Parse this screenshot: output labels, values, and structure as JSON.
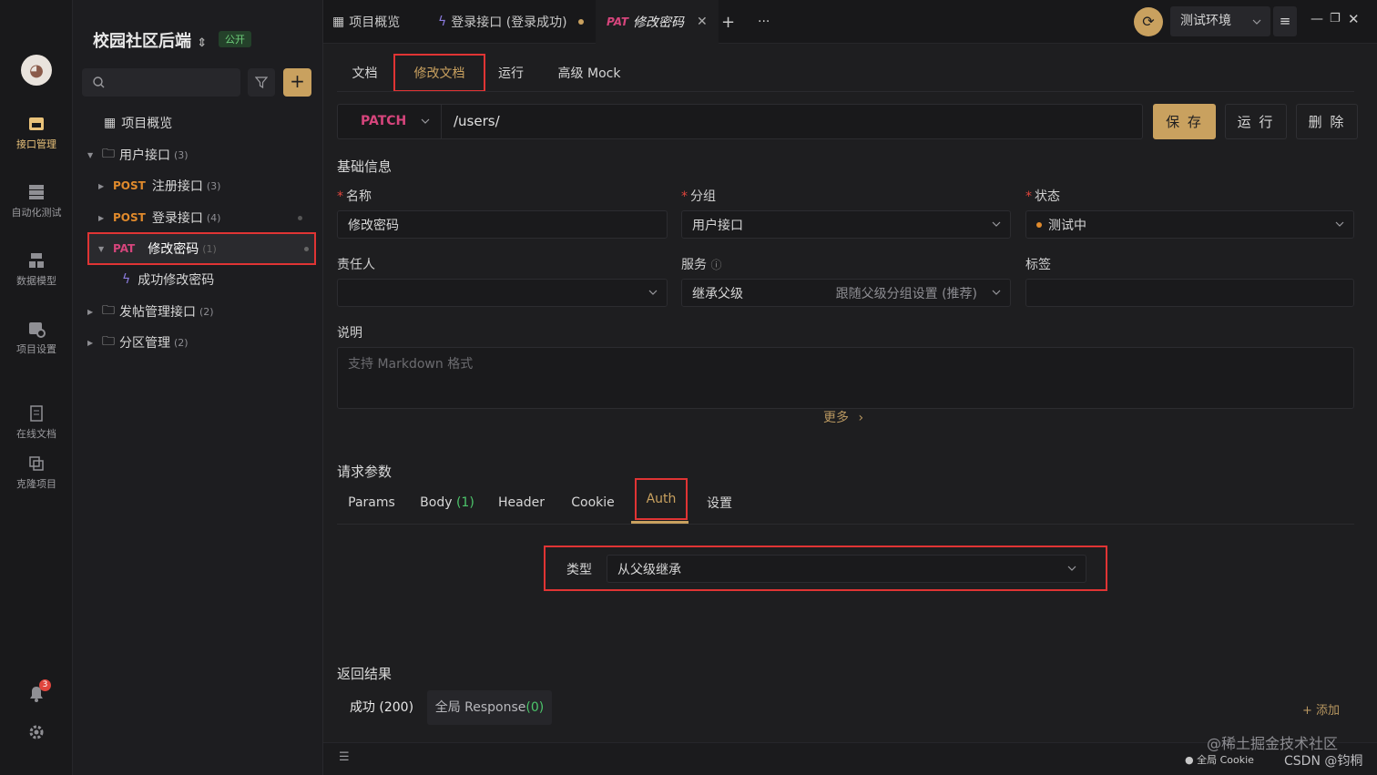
{
  "rail": {
    "items": [
      {
        "label": "接口管理",
        "icon": "api-icon"
      },
      {
        "label": "自动化测试",
        "icon": "automation-icon"
      },
      {
        "label": "数据模型",
        "icon": "data-model-icon"
      },
      {
        "label": "项目设置",
        "icon": "project-settings-icon"
      },
      {
        "label": "在线文档",
        "icon": "online-doc-icon"
      },
      {
        "label": "克隆项目",
        "icon": "clone-icon"
      }
    ],
    "notification_count": "3"
  },
  "sidebar": {
    "project_title": "校园社区后端",
    "visibility_badge": "公开",
    "tree": {
      "overview": "项目概览",
      "user_api": {
        "label": "用户接口",
        "count": "(3)"
      },
      "register": {
        "method": "POST",
        "label": "注册接口",
        "count": "(3)"
      },
      "login": {
        "method": "POST",
        "label": "登录接口",
        "count": "(4)"
      },
      "change_pwd": {
        "method": "PAT",
        "label": "修改密码",
        "count": "(1)"
      },
      "change_pwd_case": {
        "label": "成功修改密码"
      },
      "post_mgmt": {
        "label": "发帖管理接口",
        "count": "(2)"
      },
      "zone_mgmt": {
        "label": "分区管理",
        "count": "(2)"
      }
    }
  },
  "topbar": {
    "tabs": [
      {
        "label": "项目概览"
      },
      {
        "label": "登录接口 (登录成功)"
      },
      {
        "method": "PAT",
        "label": "修改密码"
      }
    ],
    "environment": "测试环境"
  },
  "editor": {
    "subtabs": [
      "文档",
      "修改文档",
      "运行",
      "高级 Mock"
    ],
    "method": "PATCH",
    "path": "/users/",
    "buttons": {
      "save": "保 存",
      "run": "运 行",
      "delete": "删 除"
    },
    "basic_info_title": "基础信息",
    "name_label": "名称",
    "name_value": "修改密码",
    "group_label": "分组",
    "group_value": "用户接口",
    "status_label": "状态",
    "status_value": "测试中",
    "owner_label": "责任人",
    "service_label": "服务",
    "service_value": "继承父级",
    "service_hint": "跟随父级分组设置 (推荐)",
    "tags_label": "标签",
    "desc_label": "说明",
    "desc_placeholder": "支持 Markdown 格式",
    "more": "更多"
  },
  "request": {
    "title": "请求参数",
    "tabs": {
      "params": "Params",
      "body": "Body",
      "body_count": "(1)",
      "header": "Header",
      "cookie": "Cookie",
      "auth": "Auth",
      "settings": "设置"
    },
    "auth_type_label": "类型",
    "auth_type_value": "从父级继承"
  },
  "response": {
    "title": "返回结果",
    "tabs": {
      "success": "成功 (200)",
      "global": "全局 Response",
      "global_count": "(0)"
    },
    "add": "+ 添加"
  },
  "footer": {
    "cookie": "全局 Cookie",
    "watermark": "@稀土掘金技术社区",
    "watermark2": "CSDN @钧桐"
  },
  "colors": {
    "accent": "#c9a15f",
    "patch": "#d6457c",
    "post": "#e08a2c",
    "highlight": "#e03434",
    "success": "#4cc46a"
  }
}
